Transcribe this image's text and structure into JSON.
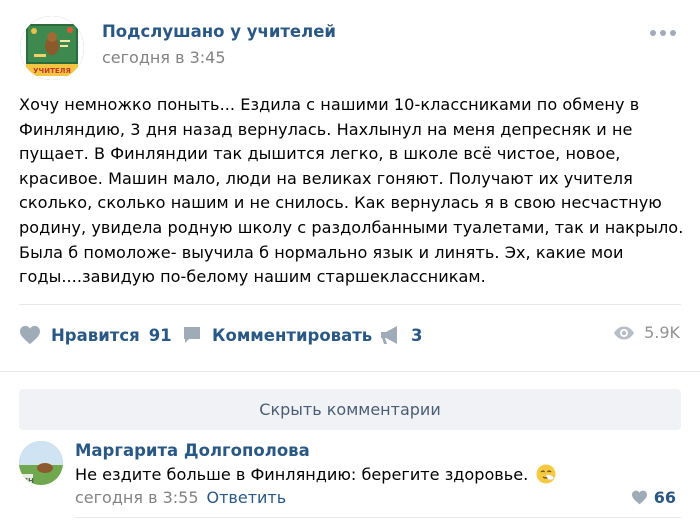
{
  "post": {
    "group_name": "Подслушано у учителей",
    "date": "сегодня в 3:45",
    "avatar_text": "УЧИТЕЛЯ",
    "text": "Хочу немножко поныть... Ездила с нашими 10-классниками по обмену в Финляндию, 3 дня назад вернулась. Нахлынул на меня депресняк и не пущает. В Финляндии так дышится легко, в школе всё чистое, новое, красивое. Машин мало, люди на великах гоняют. Получают их учителя сколько, сколько нашим и не снилось. Как вернулась я в свою несчастную родину, увидела родную школу с раздолбанными туалетами, так и накрыло. Была б помоложе- выучила б нормально язык и линять. Эх, какие мои годы....завидую по-белому нашим старшеклассникам."
  },
  "actions": {
    "like_label": "Нравится",
    "like_count": "91",
    "comment_label": "Комментировать",
    "share_count": "3",
    "views": "5.9K"
  },
  "comments_toggle": "Скрыть комментарии",
  "comment": {
    "author": "Маргарита Долгополова",
    "text": "Не ездите больше в Финляндию: берегите здоровье.",
    "date": "сегодня в 3:55",
    "reply_label": "Ответить",
    "like_count": "66"
  },
  "icons": {
    "like": "heart-icon",
    "comment": "speech-bubble-icon",
    "share": "megaphone-icon",
    "views": "eye-icon",
    "more": "more-dots-icon",
    "emoji": "sneezing-face-emoji"
  },
  "colors": {
    "link": "#2a5885",
    "icon": "#a0abb8",
    "muted": "#828282",
    "divider": "#e7e8ec",
    "button_bg": "#f0f2f5"
  }
}
